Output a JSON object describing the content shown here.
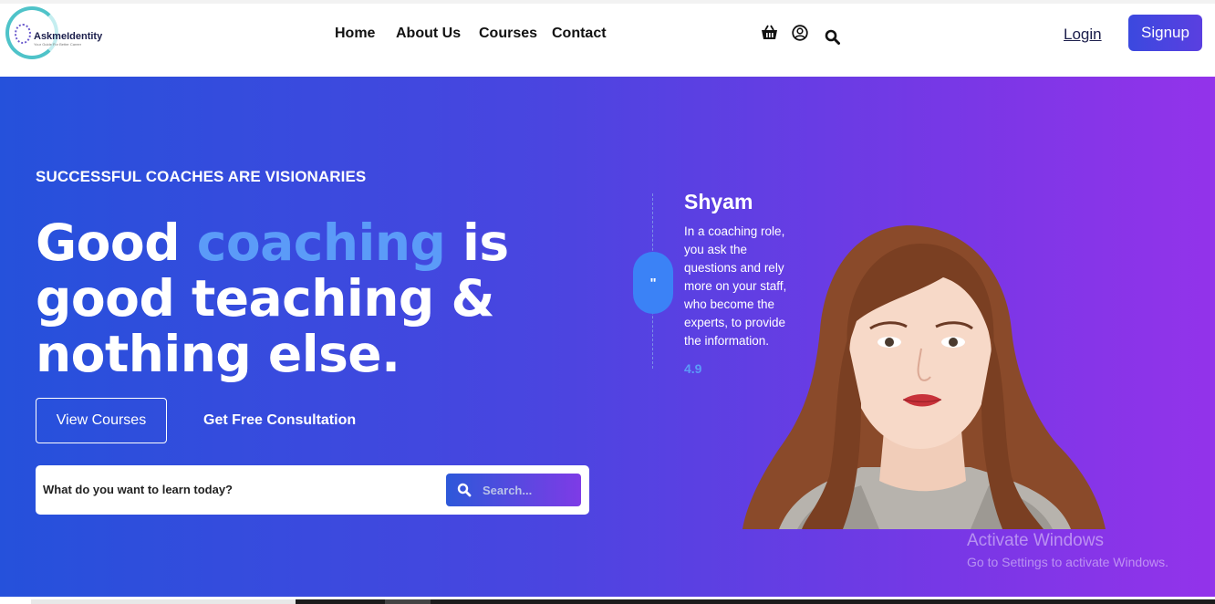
{
  "brand": {
    "name": "AskmeIdentity",
    "tagline": "Your Guide For Better Career"
  },
  "nav": {
    "items": [
      "Home",
      "About Us",
      "Courses",
      "Contact"
    ]
  },
  "header_actions": {
    "cart_icon": "basket-icon",
    "user_icon": "user-circle-icon",
    "search_icon": "search-icon",
    "login_label": "Login",
    "signup_label": "Signup"
  },
  "hero": {
    "kicker": "SUCCESSFUL COACHES ARE VISIONARIES",
    "headline_prefix": "Good ",
    "headline_highlight": "coaching",
    "headline_suffix": " is good teaching & nothing else.",
    "view_courses_label": "View Courses",
    "consultation_label": "Get Free Consultation",
    "search": {
      "prompt": "What do you want to learn today?",
      "button_label": "Search..."
    }
  },
  "testimonial": {
    "quote_mark": "\"",
    "name": "Shyam",
    "text": "In a coaching role, you ask the questions and rely more on your staff, who become the experts, to provide the information.",
    "rating": "4.9"
  },
  "os_watermark": {
    "title": "Activate Windows",
    "subtitle": "Go to Settings to activate Windows."
  },
  "colors": {
    "accent": "#5b9bf8",
    "signup": "#3b49df",
    "hero_start": "#2551db",
    "hero_end": "#9333ea"
  }
}
